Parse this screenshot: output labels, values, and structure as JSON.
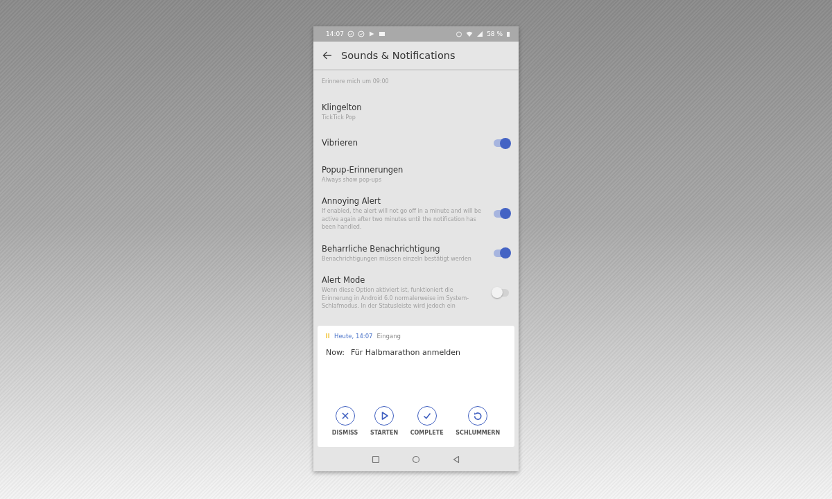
{
  "status_bar": {
    "time": "14:07",
    "battery": "58 %"
  },
  "toolbar": {
    "title": "Sounds & Notifications"
  },
  "settings": [
    {
      "kind": "plain",
      "subtitle": "Erinnere mich um 09:00"
    },
    {
      "kind": "plain",
      "title": "Klingelton",
      "subtitle": "TickTick Pop"
    },
    {
      "kind": "toggle",
      "title": "Vibrieren",
      "on": true
    },
    {
      "kind": "plain",
      "title": "Popup-Erinnerungen",
      "subtitle": "Always show pop-ups"
    },
    {
      "kind": "toggle",
      "title": "Annoying Alert",
      "subtitle": "If enabled, the alert will not go off in a minute and will be active again after two minutes until the notification has been handled.",
      "on": true
    },
    {
      "kind": "toggle",
      "title": "Beharrliche Benachrichtigung",
      "subtitle": "Benachrichtigungen müssen einzeln bestätigt werden",
      "on": true
    },
    {
      "kind": "toggle",
      "title": "Alert Mode",
      "subtitle": "Wenn diese Option aktiviert ist, funktioniert die Erinnerung in Android 6.0 normalerweise im System-Schlafmodus. In der Statusleiste wird jedoch ein",
      "on": false
    }
  ],
  "popup": {
    "time": "Heute, 14:07",
    "list": "Eingang",
    "prefix": "Now:",
    "task": "Für Halbmarathon anmelden",
    "actions": [
      {
        "kind": "dismiss",
        "label": "DISMISS"
      },
      {
        "kind": "start",
        "label": "STARTEN"
      },
      {
        "kind": "complete",
        "label": "COMPLETE"
      },
      {
        "kind": "snooze",
        "label": "SCHLUMMERN"
      }
    ]
  }
}
